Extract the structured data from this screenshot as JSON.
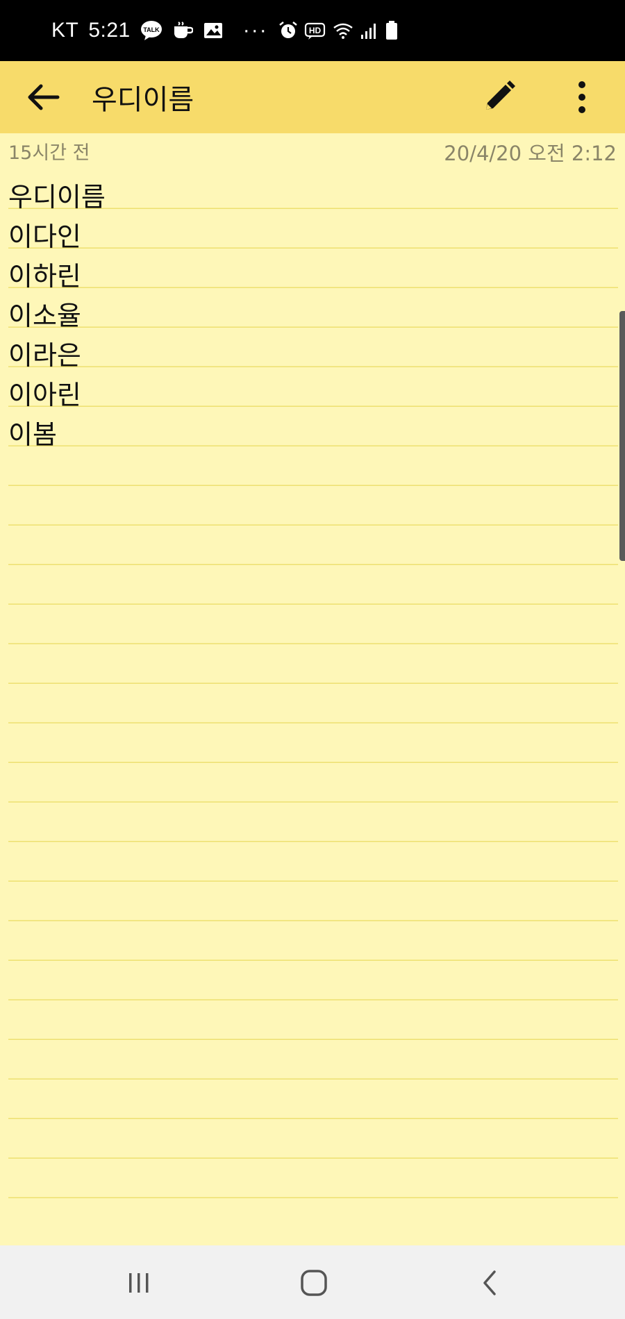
{
  "status_bar": {
    "carrier": "KT",
    "time": "5:21",
    "left_icons": [
      "talk-icon",
      "coffee-icon",
      "image-icon"
    ],
    "more_indicator": "···",
    "right_icons": [
      "alarm-icon",
      "hd-call-icon",
      "wifi-icon",
      "signal-icon",
      "battery-icon"
    ]
  },
  "toolbar": {
    "title": "우디이름",
    "back_icon": "arrow-left-icon",
    "edit_icon": "pencil-icon",
    "more_icon": "more-vertical-icon"
  },
  "meta": {
    "relative_time": "15시간 전",
    "timestamp": "20/4/20 오전 2:12"
  },
  "note": {
    "lines": [
      "우디이름",
      "이다인",
      "이하린",
      "이소율",
      "이라은",
      "이아린",
      "이봄"
    ]
  },
  "nav_bar": {
    "recents_icon": "recents-icon",
    "home_icon": "home-icon",
    "back_icon": "back-chevron-icon"
  },
  "colors": {
    "toolbar": "#f7db6a",
    "paper": "#fef7b8",
    "rule_line": "#ede070"
  }
}
